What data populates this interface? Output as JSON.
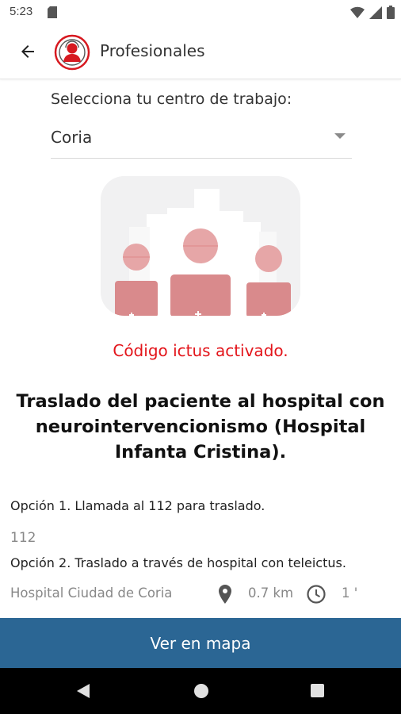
{
  "status_bar": {
    "time": "5:23",
    "icons": [
      "sd-card-icon",
      "wifi-icon",
      "signal-icon",
      "battery-icon"
    ]
  },
  "app_bar": {
    "title": "Profesionales",
    "back_icon": "arrow-back-icon",
    "logo_icon": "professional-avatar-logo"
  },
  "center_select": {
    "label": "Selecciona tu centro de trabajo:",
    "value": "Coria"
  },
  "alert": {
    "text": "Código ictus activado."
  },
  "heading": {
    "text": "Traslado del paciente al hospital con neurointervencionismo (Hospital Infanta Cristina)."
  },
  "options": {
    "option1": "Opción 1. Llamada al 112 para traslado.",
    "phone": "112",
    "option2": "Opción 2. Traslado a través de hospital con teleictus."
  },
  "hospital": {
    "name": "Hospital Ciudad de Coria",
    "distance": "0.7 km",
    "time": "1 '"
  },
  "map_button": {
    "label": "Ver en mapa"
  },
  "colors": {
    "accent_red": "#e3151b",
    "button_blue": "#2b6694",
    "muted_text": "#888888"
  }
}
